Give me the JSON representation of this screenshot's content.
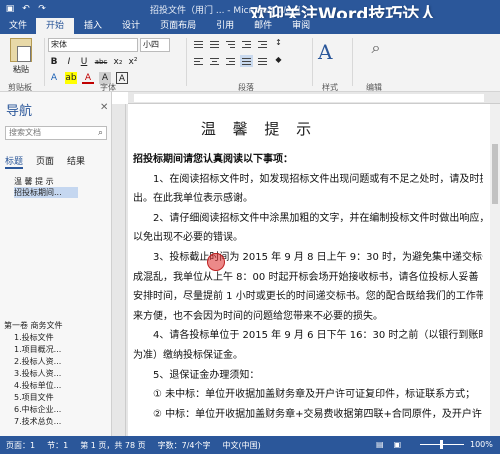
{
  "titlebar": {
    "doc_title": "招投文件（用门 ... - Microsoft Word",
    "watermark": "欢迎关注Word技巧达人",
    "qat": [
      "save-icon",
      "undo-icon",
      "redo-icon"
    ]
  },
  "tabs": [
    "文件",
    "开始",
    "插入",
    "设计",
    "页面布局",
    "引用",
    "邮件",
    "审阅"
  ],
  "ribbon": {
    "paste_label": "粘贴",
    "font_name": "宋体",
    "font_size": "小四",
    "font_buttons": [
      "B",
      "I",
      "U",
      "abc",
      "x₂",
      "x²"
    ],
    "font_row3": [
      "A",
      "ab",
      "A",
      "A",
      "A"
    ],
    "group_clipboard": "剪贴板",
    "group_font": "字体",
    "group_paragraph": "段落",
    "styles_label": "样式",
    "editing_label": "编辑",
    "styles_group": "样式"
  },
  "nav": {
    "title": "导航",
    "search_placeholder": "搜索文档",
    "tabs": [
      "标题",
      "页面",
      "结果"
    ],
    "items": [
      "温 馨 提 示",
      "招投标期间..."
    ],
    "outline": [
      "第一卷 商务文件",
      "1.投标文件",
      "1.项目概况...",
      "2.投标人资...",
      "3.投标人资...",
      "4.投标单位...",
      "5.项目文件",
      "6.中标企业...",
      "7.技术总负..."
    ]
  },
  "document": {
    "heading": "温 馨 提 示",
    "lines": [
      {
        "text": "招投标期间请您认真阅读以下事项：",
        "bold": true
      },
      {
        "text": "　　1、在阅读招标文件时，如发现招标文件出现问题或有不足之处时，请及时提",
        "bold": false
      },
      {
        "text": "出。在此我单位表示感谢。",
        "bold": false
      },
      {
        "text": "　　2、请仔细阅读招标文件中涂黑加粗的文字，并在编制投标文件时做出响应，",
        "bold": false
      },
      {
        "text": "以免出现不必要的错误。",
        "bold": false
      },
      {
        "text": "　　3、投标截止时间为 2015 年 9 月 8 日上午 9：30 时，为避免集中递交标书造",
        "bold": false
      },
      {
        "text": "成混乱，我单位从上午 8：00 时起开标会场开始接收标书，请各位投标人妥善",
        "bold": false
      },
      {
        "text": "安排时间，尽量提前 1 小时或更长的时间递交标书。您的配合既给我们的工作带",
        "bold": false
      },
      {
        "text": "来方便，也不会因为时间的问题给您带来不必要的损失。",
        "bold": false
      },
      {
        "text": "　　4、请各投标单位于 2015 年 9 月 6 日下午 16：30 时之前（以银行到账时间",
        "bold": false
      },
      {
        "text": "为准）缴纳投标保证金。",
        "bold": false
      },
      {
        "text": "　　5、退保证金办理须知：",
        "bold": false
      },
      {
        "text": "　　① 未中标：单位开收据加盖财务章及开户许可证复印件，标证联系方式；",
        "bold": false
      },
      {
        "text": "　　② 中标：单位开收据加盖财务章+交易费收据第四联+合同原件，及开户许",
        "bold": false
      }
    ]
  },
  "statusbar": {
    "page": "页面：1",
    "section": "节：1",
    "pages": "第 1 页，共 78 页",
    "words": "字数：7/4个字",
    "lang": "中文(中国)",
    "zoom": "100%"
  },
  "colors": {
    "accent": "#2b579a",
    "ribbon_bg": "#f3f3f3",
    "cursor_highlight": "#dc2828"
  }
}
